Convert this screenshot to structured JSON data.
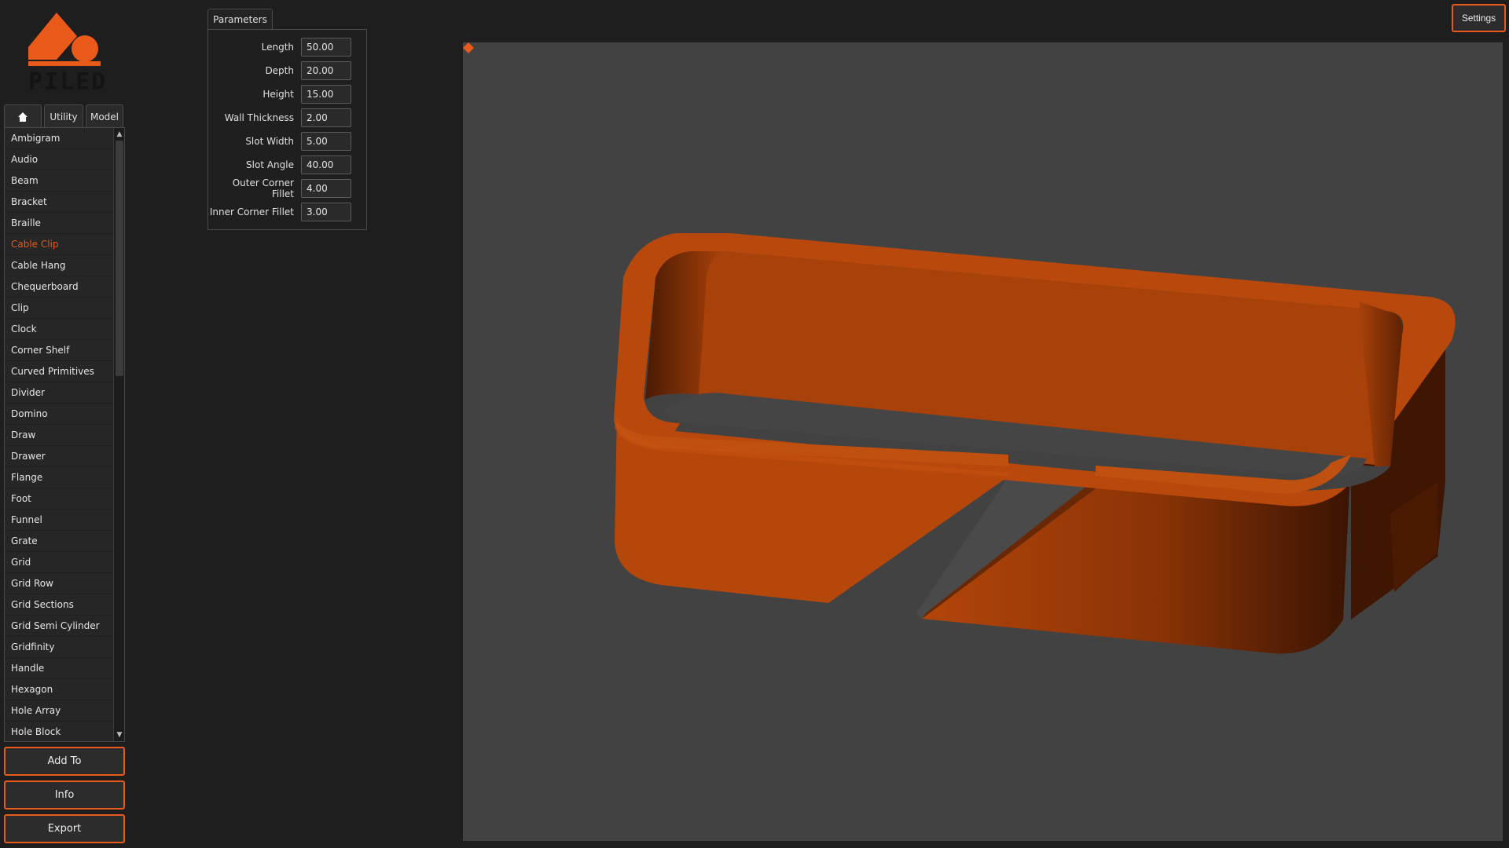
{
  "brand": {
    "logo_text": "PILED",
    "accent_color": "#e8591a"
  },
  "tabs": [
    {
      "id": "home",
      "label": "",
      "icon": "home-icon"
    },
    {
      "id": "utility",
      "label": "Utility"
    },
    {
      "id": "model",
      "label": "Model"
    }
  ],
  "model_list": {
    "selected": "Cable Clip",
    "items": [
      "Ambigram",
      "Audio",
      "Beam",
      "Bracket",
      "Braille",
      "Cable Clip",
      "Cable Hang",
      "Chequerboard",
      "Clip",
      "Clock",
      "Corner Shelf",
      "Curved Primitives",
      "Divider",
      "Domino",
      "Draw",
      "Drawer",
      "Flange",
      "Foot",
      "Funnel",
      "Grate",
      "Grid",
      "Grid Row",
      "Grid Sections",
      "Grid Semi Cylinder",
      "Gridfinity",
      "Handle",
      "Hexagon",
      "Hole Array",
      "Hole Block"
    ]
  },
  "buttons": {
    "add_to": "Add To",
    "info": "Info",
    "export": "Export",
    "settings": "Settings"
  },
  "parameters": {
    "tab_label": "Parameters",
    "fields": [
      {
        "label": "Length",
        "value": "50.00"
      },
      {
        "label": "Depth",
        "value": "20.00"
      },
      {
        "label": "Height",
        "value": "15.00"
      },
      {
        "label": "Wall Thickness",
        "value": "2.00"
      },
      {
        "label": "Slot Width",
        "value": "5.00"
      },
      {
        "label": "Slot Angle",
        "value": "40.00"
      },
      {
        "label": "Outer Corner Fillet",
        "value": "4.00"
      },
      {
        "label": "Inner Corner Fillet",
        "value": "3.00"
      }
    ]
  },
  "viewport": {
    "background": "#424242",
    "model_color": "#b3450a",
    "pivot_icon": "pivot-diamond-icon"
  }
}
